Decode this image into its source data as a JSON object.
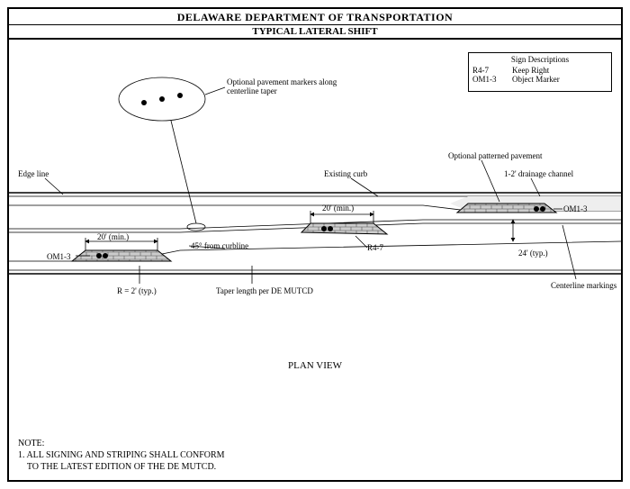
{
  "header": {
    "org": "DELAWARE DEPARTMENT OF TRANSPORTATION",
    "title": "TYPICAL LATERAL SHIFT"
  },
  "legend": {
    "title": "Sign Descriptions",
    "rows": [
      {
        "code": "R4-7",
        "desc": "Keep Right"
      },
      {
        "code": "OM1-3",
        "desc": "Object Marker"
      }
    ]
  },
  "labels": {
    "opt_markers": "Optional pavement markers along centerline taper",
    "edge_line": "Edge line",
    "existing_curb": "Existing curb",
    "opt_pavement": "Optional patterned pavement",
    "drainage": "1-2' drainage channel",
    "om_left": "OM1-3",
    "om_right": "OM1-3",
    "r47": "R4-7",
    "dim20_left": "20' (min.)",
    "dim20_mid": "20' (min.)",
    "angle45": "45° from curbline",
    "r2": "R = 2' (typ.)",
    "taper": "Taper length per DE MUTCD",
    "width24": "24' (typ.)",
    "centerline": "Centerline markings",
    "plan_view": "PLAN VIEW"
  },
  "note": {
    "heading": "NOTE:",
    "item1": "1. ALL SIGNING AND STRIPING SHALL CONFORM",
    "item1b": "    TO THE LATEST EDITION OF THE DE MUTCD."
  }
}
